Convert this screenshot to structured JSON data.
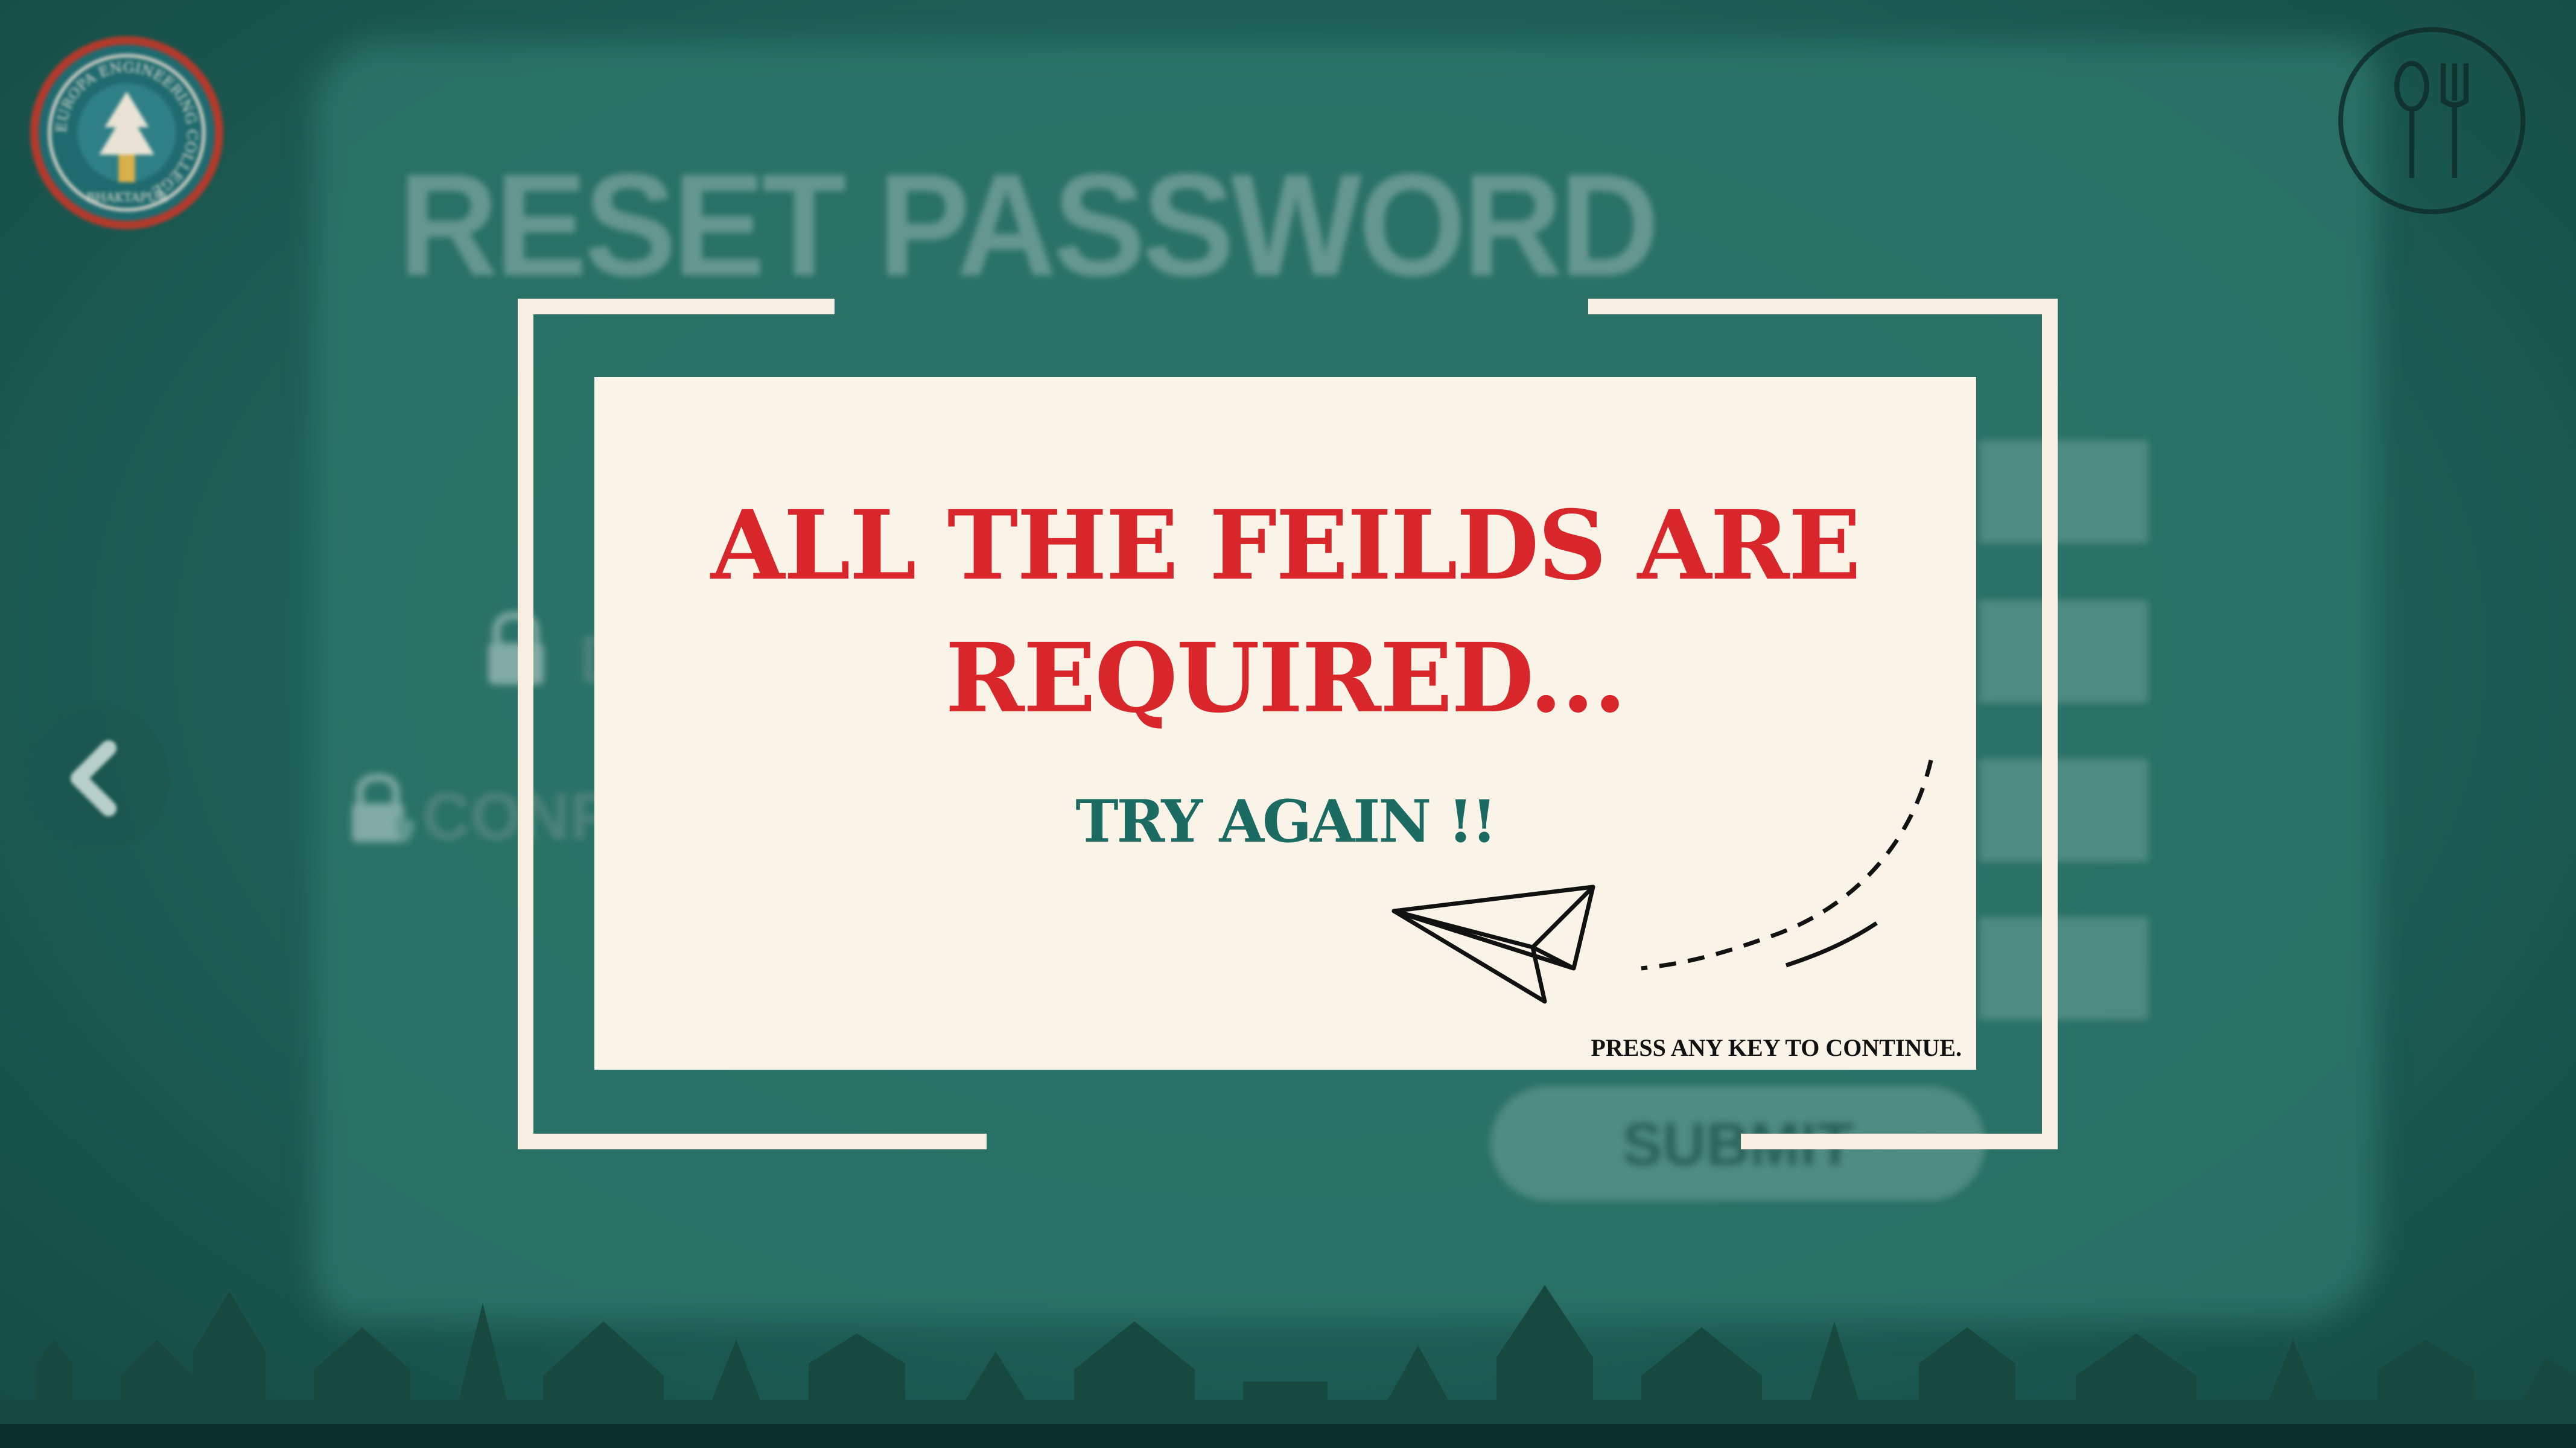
{
  "app": {
    "logo_text": "EUROPA ENGINEERING COLLEGE",
    "logo_subtext": "BHAKTAPUR"
  },
  "background": {
    "title": "RESET PASSWORD",
    "confirm_label": "CONF",
    "submit_label": "SUBMIT"
  },
  "dialog": {
    "title_line1": "ALL THE FEILDS ARE",
    "title_line2": "REQUIRED...",
    "subtitle": "TRY AGAIN !!",
    "hint": "PRESS ANY KEY TO CONTINUE."
  },
  "colors": {
    "background": "#1d5f57",
    "card": "#faf3e8",
    "error_text": "#d8262b",
    "accent_text": "#1b6b62"
  },
  "icons": {
    "logo": "college-seal-icon",
    "food": "fork-spoon-icon",
    "back": "chevron-left-icon",
    "lock": "lock-icon",
    "plane": "paper-plane-icon"
  }
}
